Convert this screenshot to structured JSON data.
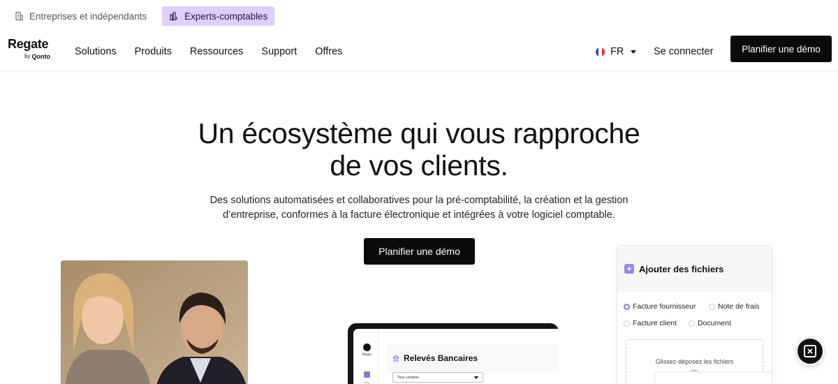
{
  "audience": {
    "items": [
      {
        "label": "Entreprises et indépendants",
        "active": false,
        "icon": "building-icon"
      },
      {
        "label": "Experts-comptables",
        "active": true,
        "icon": "chart-bars-icon"
      }
    ]
  },
  "header": {
    "logo_text": "Regate",
    "logo_by": "by",
    "logo_brand": "Qonto",
    "nav": [
      "Solutions",
      "Produits",
      "Ressources",
      "Support",
      "Offres"
    ],
    "language": "FR",
    "login_label": "Se connecter",
    "cta_label": "Planifier une démo"
  },
  "hero": {
    "title_line1": "Un écosystème qui vous rapproche",
    "title_line2": "de vos clients.",
    "subtitle_line1": "Des solutions automatisées et collaboratives pour la pré-comptabilité, la création et la gestion",
    "subtitle_line2": "d’entreprise, conformes à la facture électronique et intégrées à votre logiciel comptable.",
    "cta_label": "Planifier une démo"
  },
  "laptop": {
    "app_label": "Rega..",
    "section_title": "Relevés Bancaires",
    "select_value": "Tous comptes"
  },
  "upload_card": {
    "title": "Ajouter des fichiers",
    "options": [
      {
        "label": "Facture fournisseur",
        "selected": true
      },
      {
        "label": "Note de frais",
        "selected": false
      },
      {
        "label": "Facture client",
        "selected": false
      },
      {
        "label": "Document",
        "selected": false
      }
    ],
    "drop_text": "Glissez-déposez les fichiers",
    "or_text": "ou"
  },
  "colors": {
    "accent": "#dcd0ff",
    "accent_purple": "#8a7ad8",
    "button_bg": "#0a0a0a"
  }
}
